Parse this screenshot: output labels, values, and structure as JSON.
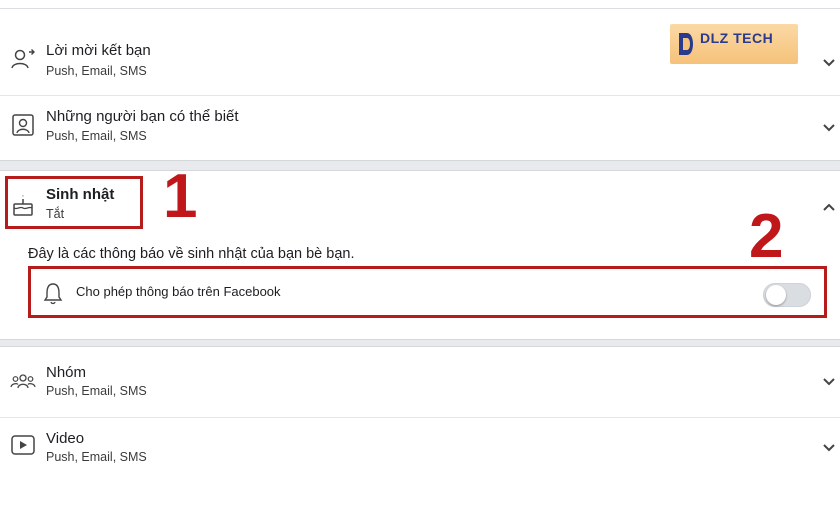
{
  "rows": {
    "friend_requests": {
      "title": "Lời mời kết bạn",
      "sub": "Push, Email, SMS"
    },
    "people_you_may_know": {
      "title": "Những người bạn có thể biết",
      "sub": "Push, Email, SMS"
    },
    "birthdays": {
      "title": "Sinh nhật",
      "sub": "Tắt"
    },
    "groups": {
      "title": "Nhóm",
      "sub": "Push, Email, SMS"
    },
    "video": {
      "title": "Video",
      "sub": "Push, Email, SMS"
    }
  },
  "birthday_panel": {
    "description": "Đây là các thông báo về sinh nhật của bạn bè bạn.",
    "toggle_label": "Cho phép thông báo trên Facebook",
    "toggle_on": false
  },
  "annotations": {
    "step1": "1",
    "step2": "2"
  },
  "watermark": {
    "brand": "DLZ TECH"
  },
  "colors": {
    "highlight": "#b71c1c",
    "step_number": "#c0171b",
    "toggle_off": "#dadde1"
  },
  "icons": [
    "person-add-icon",
    "contact-card-icon",
    "birthday-cake-icon",
    "bell-icon",
    "group-icon",
    "video-play-icon",
    "chevron-down-icon",
    "chevron-up-icon"
  ]
}
